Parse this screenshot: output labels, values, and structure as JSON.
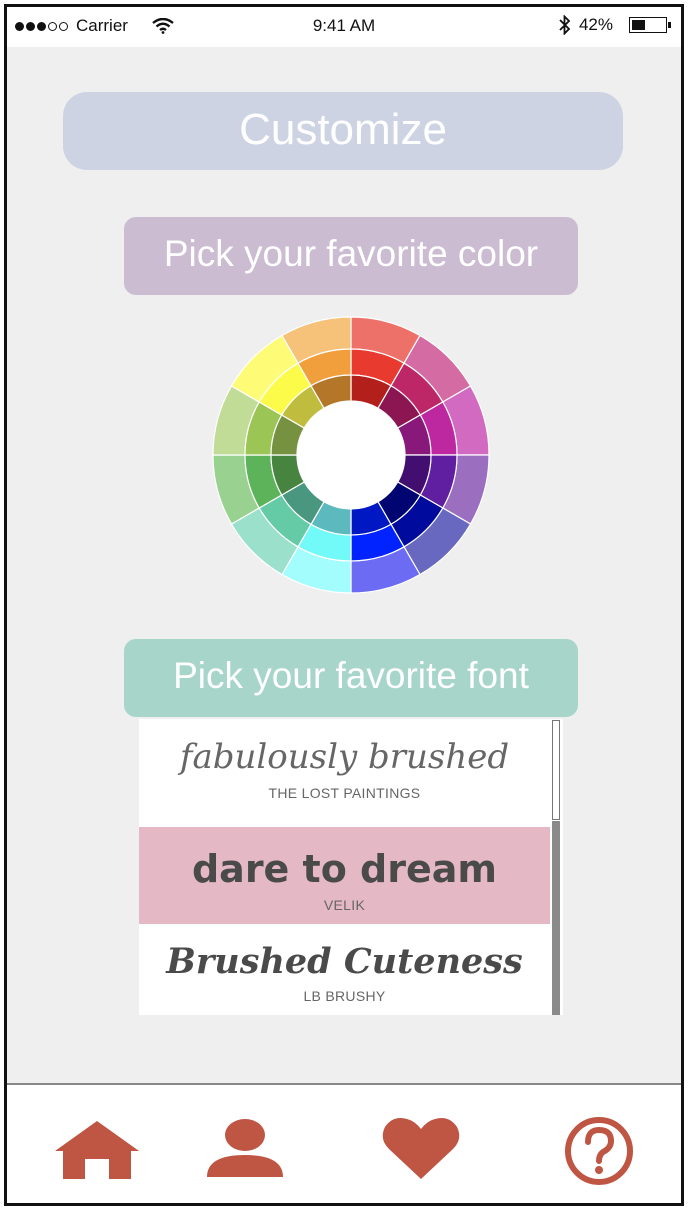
{
  "status_bar": {
    "carrier": "Carrier",
    "time": "9:41 AM",
    "battery": "42%",
    "battery_level": 0.42,
    "signal_bars_filled": 3,
    "signal_bars_total": 5
  },
  "header": {
    "title": "Customize"
  },
  "color_section": {
    "label": "Pick your favorite color",
    "wheel_colors": {
      "outer": [
        "#ee7169",
        "#d46ba2",
        "#d26ac1",
        "#9b6ec0",
        "#6868c0",
        "#6b6bf3",
        "#a4fdfd",
        "#9ae0cb",
        "#98d190",
        "#c1dc96",
        "#fefc76",
        "#f6c178"
      ],
      "middle": [
        "#e93a30",
        "#bd2667",
        "#bd28a0",
        "#601ea0",
        "#000b9e",
        "#0023ff",
        "#72faf9",
        "#65cba7",
        "#5cb35a",
        "#9bc554",
        "#fdfb4a",
        "#f19e3d"
      ],
      "inner": [
        "#b31f1a",
        "#8b1651",
        "#88187a",
        "#420f70",
        "#000572",
        "#0017c4",
        "#5cb9be",
        "#48977e",
        "#478440",
        "#769240",
        "#c0bc3e",
        "#b4772a"
      ]
    }
  },
  "font_section": {
    "label": "Pick your favorite font",
    "fonts": [
      {
        "sample": "fabulously brushed",
        "name": "THE LOST PAINTINGS",
        "selected": false
      },
      {
        "sample": "dare to dream",
        "name": "VELIK",
        "selected": true
      },
      {
        "sample": "Brushed Cuteness",
        "name": "LB BRUSHY",
        "selected": false
      }
    ],
    "selected_color": "#e5b8c6"
  },
  "tab_bar": {
    "accent_color": "#bf5543",
    "tabs": [
      {
        "icon": "home-icon"
      },
      {
        "icon": "profile-icon"
      },
      {
        "icon": "heart-icon"
      },
      {
        "icon": "help-icon"
      }
    ]
  }
}
